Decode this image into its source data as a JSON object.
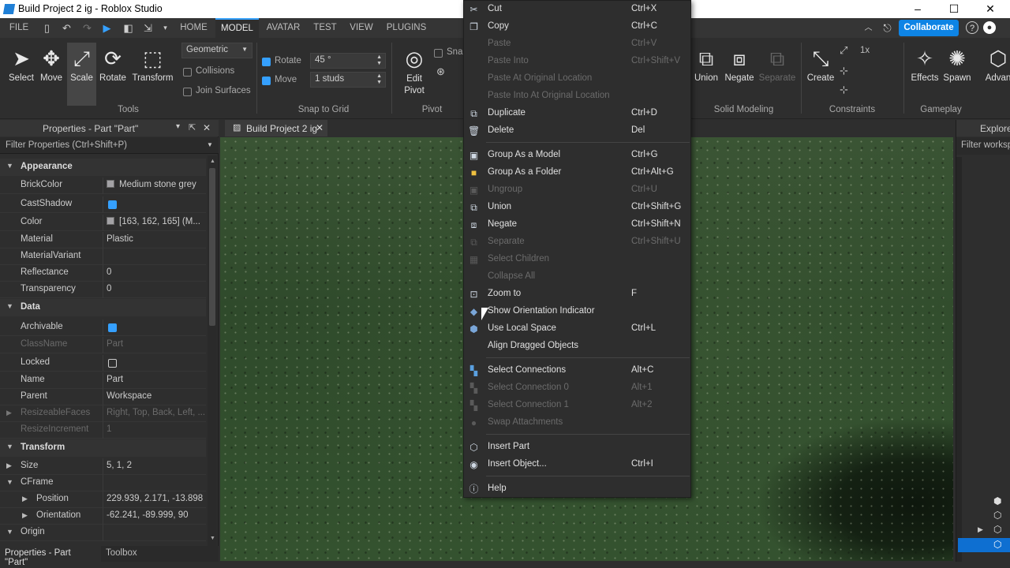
{
  "window": {
    "title": "Build Project 2 ig - Roblox Studio"
  },
  "menubar": {
    "file": "FILE",
    "tabs": [
      "HOME",
      "MODEL",
      "AVATAR",
      "TEST",
      "VIEW",
      "PLUGINS"
    ],
    "active_tab": "MODEL",
    "collaborate": "Collaborate"
  },
  "ribbon": {
    "tools": {
      "select": "Select",
      "move": "Move",
      "scale": "Scale",
      "rotate": "Rotate",
      "transform": "Transform",
      "label": "Tools"
    },
    "mode": "Geometric",
    "collisions": "Collisions",
    "join_surfaces": "Join Surfaces",
    "snap": {
      "rotate_label": "Rotate",
      "rotate_value": "45 °",
      "move_label": "Move",
      "move_value": "1 studs",
      "label": "Snap to Grid"
    },
    "pivot": {
      "edit": "Edit",
      "pivot": "Pivot",
      "label": "Pivot",
      "snap": "Snap"
    },
    "solid": {
      "union": "Union",
      "negate": "Negate",
      "separate": "Separate",
      "label": "Solid Modeling"
    },
    "constraints": {
      "create": "Create",
      "scale": "1x",
      "label": "Constraints"
    },
    "gameplay": {
      "effects": "Effects",
      "spawn": "Spawn",
      "advanced": "Advan",
      "label": "Gameplay"
    }
  },
  "properties": {
    "title": "Properties - Part \"Part\"",
    "filter": "Filter Properties (Ctrl+Shift+P)",
    "appearance": "Appearance",
    "brickcolor": {
      "name": "BrickColor",
      "value": "Medium stone grey"
    },
    "castshadow": {
      "name": "CastShadow"
    },
    "color": {
      "name": "Color",
      "value": "[163, 162, 165] (M..."
    },
    "material": {
      "name": "Material",
      "value": "Plastic"
    },
    "materialvariant": {
      "name": "MaterialVariant",
      "value": ""
    },
    "reflectance": {
      "name": "Reflectance",
      "value": "0"
    },
    "transparency": {
      "name": "Transparency",
      "value": "0"
    },
    "data": "Data",
    "archivable": {
      "name": "Archivable"
    },
    "classname": {
      "name": "ClassName",
      "value": "Part"
    },
    "locked": {
      "name": "Locked"
    },
    "pname": {
      "name": "Name",
      "value": "Part"
    },
    "parent": {
      "name": "Parent",
      "value": "Workspace"
    },
    "resizeablefaces": {
      "name": "ResizeableFaces",
      "value": "Right, Top, Back, Left, ..."
    },
    "resizeincrement": {
      "name": "ResizeIncrement",
      "value": "1"
    },
    "transform": "Transform",
    "size": {
      "name": "Size",
      "value": "5, 1, 2"
    },
    "cframe": {
      "name": "CFrame"
    },
    "position": {
      "name": "Position",
      "value": "229.939, 2.171, -13.898"
    },
    "orientation": {
      "name": "Orientation",
      "value": "-62.241, -89.999, 90"
    },
    "origin": {
      "name": "Origin"
    }
  },
  "bottom_tabs": {
    "props": "Properties - Part \"Part\"",
    "toolbox": "Toolbox"
  },
  "viewport": {
    "tab": "Build Project 2 ig"
  },
  "explorer": {
    "title": "Explore",
    "filter": "Filter worksp"
  },
  "context_menu": {
    "cut": {
      "label": "Cut",
      "shortcut": "Ctrl+X"
    },
    "copy": {
      "label": "Copy",
      "shortcut": "Ctrl+C"
    },
    "paste": {
      "label": "Paste",
      "shortcut": "Ctrl+V"
    },
    "paste_into": {
      "label": "Paste Into",
      "shortcut": "Ctrl+Shift+V"
    },
    "paste_orig": {
      "label": "Paste At Original Location",
      "shortcut": ""
    },
    "paste_into_orig": {
      "label": "Paste Into At Original Location",
      "shortcut": ""
    },
    "duplicate": {
      "label": "Duplicate",
      "shortcut": "Ctrl+D"
    },
    "delete": {
      "label": "Delete",
      "shortcut": "Del"
    },
    "group_model": {
      "label": "Group As a Model",
      "shortcut": "Ctrl+G"
    },
    "group_folder": {
      "label": "Group As a Folder",
      "shortcut": "Ctrl+Alt+G"
    },
    "ungroup": {
      "label": "Ungroup",
      "shortcut": "Ctrl+U"
    },
    "union": {
      "label": "Union",
      "shortcut": "Ctrl+Shift+G"
    },
    "negate": {
      "label": "Negate",
      "shortcut": "Ctrl+Shift+N"
    },
    "separate": {
      "label": "Separate",
      "shortcut": "Ctrl+Shift+U"
    },
    "select_children": {
      "label": "Select Children",
      "shortcut": ""
    },
    "collapse_all": {
      "label": "Collapse All",
      "shortcut": ""
    },
    "zoom_to": {
      "label": "Zoom to",
      "shortcut": "F"
    },
    "show_orientation": {
      "label": "Show Orientation Indicator",
      "shortcut": ""
    },
    "local_space": {
      "label": "Use Local Space",
      "shortcut": "Ctrl+L"
    },
    "align_dragged": {
      "label": "Align Dragged Objects",
      "shortcut": ""
    },
    "select_connections": {
      "label": "Select Connections",
      "shortcut": "Alt+C"
    },
    "select_conn0": {
      "label": "Select Connection 0",
      "shortcut": "Alt+1"
    },
    "select_conn1": {
      "label": "Select Connection 1",
      "shortcut": "Alt+2"
    },
    "swap_attach": {
      "label": "Swap Attachments",
      "shortcut": ""
    },
    "insert_part": {
      "label": "Insert Part",
      "shortcut": ""
    },
    "insert_object": {
      "label": "Insert Object...",
      "shortcut": "Ctrl+I"
    },
    "help": {
      "label": "Help",
      "shortcut": ""
    }
  }
}
